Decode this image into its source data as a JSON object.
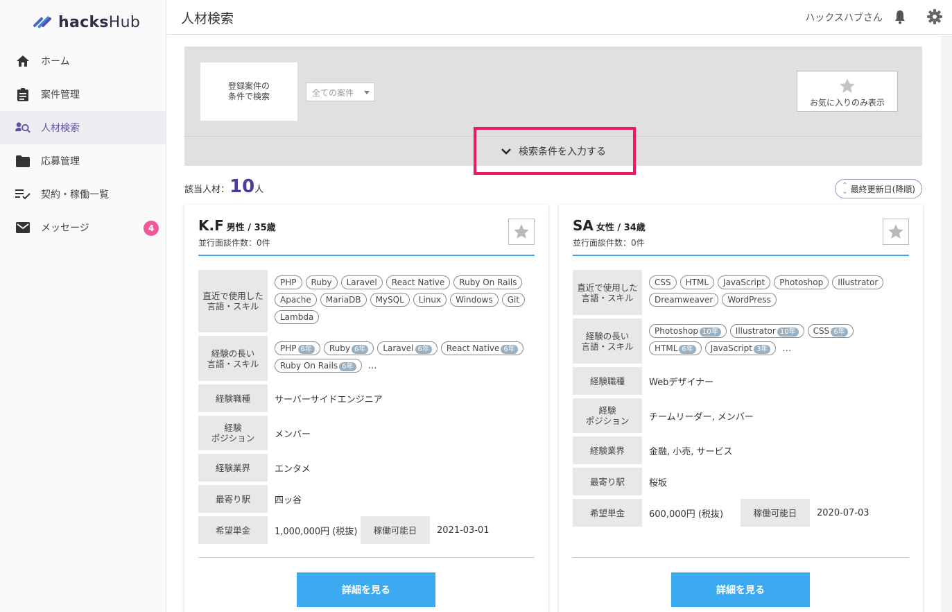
{
  "app": {
    "logo_a": "hacks",
    "logo_b": "Hub"
  },
  "sidebar": {
    "items": [
      {
        "label": "ホーム"
      },
      {
        "label": "案件管理"
      },
      {
        "label": "人材検索"
      },
      {
        "label": "応募管理"
      },
      {
        "label": "契約・稼働一覧"
      },
      {
        "label": "メッセージ",
        "badge": "4"
      }
    ]
  },
  "header": {
    "title": "人材検索",
    "user": "ハックスハブさん"
  },
  "search": {
    "registered_label": "登録案件の\n条件で検索",
    "select_value": "全ての案件",
    "favorite_label": "お気に入りのみ表示",
    "expand_label": "検索条件を入力する"
  },
  "results": {
    "prefix": "該当人材：",
    "count": "10",
    "suffix": "人",
    "sort_label": "最終更新日(降順)"
  },
  "labels": {
    "recent": "直近で使用した\n言語・スキル",
    "long": "経験の長い\n言語・スキル",
    "job": "経験職種",
    "position": "経験\nポジション",
    "industry": "経験業界",
    "station": "最寄り駅",
    "rate": "希望単金",
    "available": "稼働可能日",
    "detail": "詳細を見る",
    "more": "…"
  },
  "cards": [
    {
      "name": "K.F",
      "sub": "男性 / 35歳",
      "interviews": "並行面談件数：0件",
      "recent_skills": [
        "PHP",
        "Ruby",
        "Laravel",
        "React Native",
        "Ruby On Rails",
        "Apache",
        "MariaDB",
        "MySQL",
        "Linux",
        "Windows",
        "Git",
        "Lambda"
      ],
      "long_skills": [
        {
          "name": "PHP",
          "years": "6年"
        },
        {
          "name": "Ruby",
          "years": "6年"
        },
        {
          "name": "Laravel",
          "years": "6年"
        },
        {
          "name": "React Native",
          "years": "6年"
        },
        {
          "name": "Ruby On Rails",
          "years": "6年"
        }
      ],
      "job": "サーバーサイドエンジニア",
      "position": "メンバー",
      "industry": "エンタメ",
      "station": "四ッ谷",
      "rate": "1,000,000円 (税抜)",
      "available": "2021-03-01"
    },
    {
      "name": "SA",
      "sub": "女性 / 34歳",
      "interviews": "並行面談件数：0件",
      "recent_skills": [
        "CSS",
        "HTML",
        "JavaScript",
        "Photoshop",
        "Illustrator",
        "Dreamweaver",
        "WordPress"
      ],
      "long_skills": [
        {
          "name": "Photoshop",
          "years": "10年"
        },
        {
          "name": "Illustrator",
          "years": "10年"
        },
        {
          "name": "CSS",
          "years": "6年"
        },
        {
          "name": "HTML",
          "years": "6年"
        },
        {
          "name": "JavaScript",
          "years": "3年"
        }
      ],
      "job": "Webデザイナー",
      "position": "チームリーダー, メンバー",
      "industry": "金融, 小売, サービス",
      "station": "桜坂",
      "rate": "600,000円 (税抜)",
      "available": "2020-07-03"
    }
  ]
}
